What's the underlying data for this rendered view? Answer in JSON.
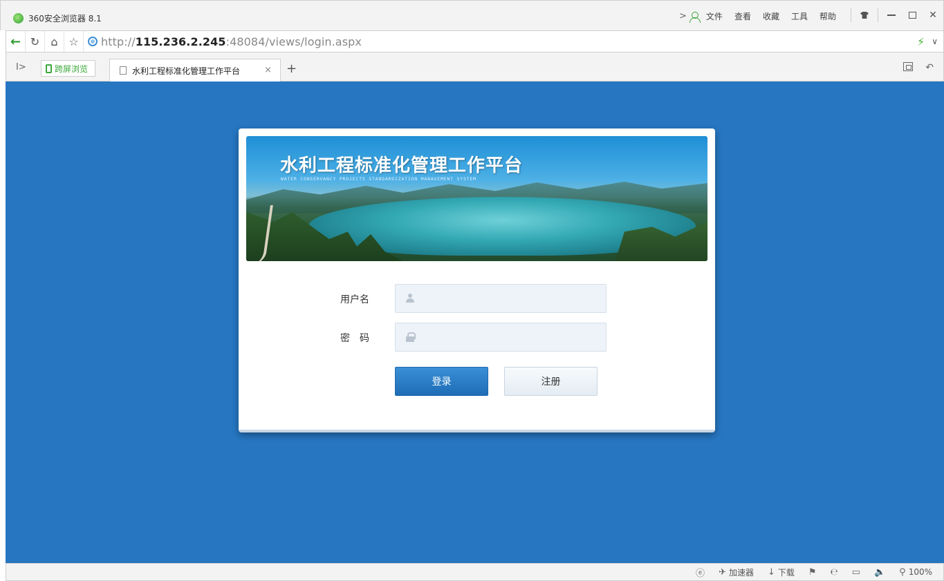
{
  "window": {
    "title": "360安全浏览器 8.1",
    "menu": [
      "文件",
      "查看",
      "收藏",
      "工具",
      "帮助"
    ],
    "more_arrow": ">"
  },
  "address": {
    "url_prefix": "http://",
    "url_host": "115.236.2.245",
    "url_rest": ":48084/views/login.aspx"
  },
  "tabs": {
    "cross_screen_label": "跨屏浏览",
    "active_tab_title": "水利工程标准化管理工作平台",
    "close_glyph": "×",
    "new_tab_glyph": "+"
  },
  "login": {
    "banner_title": "水利工程标准化管理工作平台",
    "banner_subtitle": "WATER CONSERVANCY PROJECTS STANDARDIZATION MANAGEMENT SYSTEM",
    "username_label": "用户名",
    "password_label": "密　码",
    "username_value": "",
    "password_value": "",
    "login_button": "登录",
    "register_button": "注册"
  },
  "status": {
    "accelerator": "加速器",
    "download": "下载",
    "zoom": "100%"
  },
  "colors": {
    "page_background": "#2676c1",
    "login_button": "#1e6db6",
    "browser_accent": "#3aa83a"
  }
}
